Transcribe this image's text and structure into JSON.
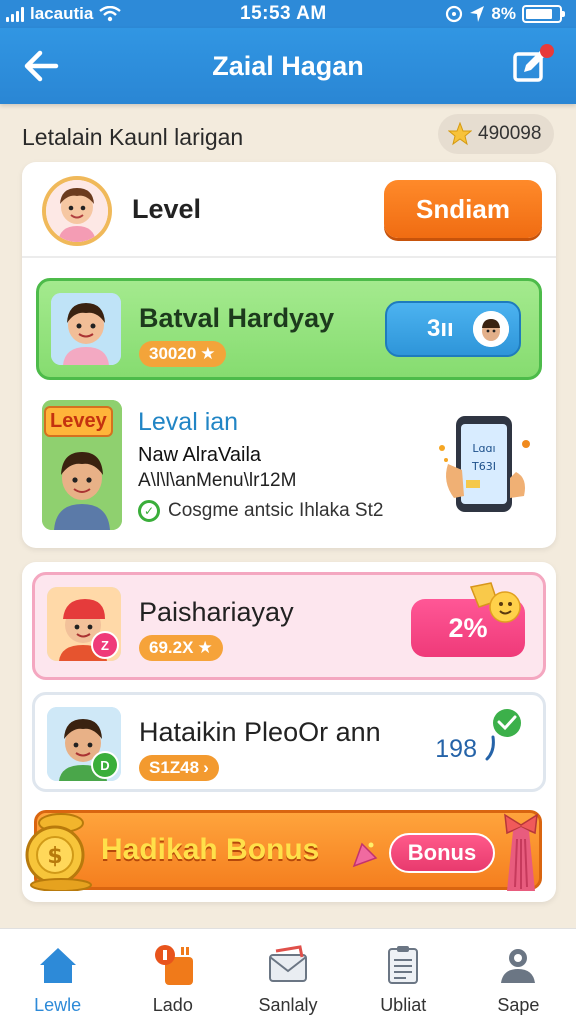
{
  "status_bar": {
    "carrier": "lacautia",
    "time": "15:53 AM",
    "battery_text": "8%",
    "battery_level": 0.8
  },
  "header": {
    "title": "Zaial Hagan",
    "back_icon": "arrow-left-icon",
    "edit_icon": "edit-square-icon"
  },
  "section": {
    "title": "Letalain Kaunl larigan",
    "star_count": "490098"
  },
  "level_row": {
    "label": "Level",
    "button_label": "Sndiam"
  },
  "green_row": {
    "title": "Batval Hardyay",
    "pill_value": "30020",
    "button_value": "3ıı"
  },
  "promo": {
    "badge": "Levey",
    "title": "Leval ian",
    "subtitle": "Naw AlraVaila",
    "subtitle2": "A\\l\\l\\anMenu\\lr12M",
    "check_text": "Cosgme antsic Ihlaka St2"
  },
  "list": [
    {
      "title": "Paishariayay",
      "pill_value": "69.2X",
      "action": "2%",
      "badge": "Z"
    },
    {
      "title": "Hataikin PleoOr ann",
      "pill_value": "S1Z48",
      "count": "198",
      "badge": "D"
    }
  ],
  "bonus": {
    "text": "Hadikah Bonus",
    "button_label": "Bonus"
  },
  "nav": [
    {
      "label": "Lewle",
      "icon": "home-icon",
      "active": true
    },
    {
      "label": "Lado",
      "icon": "gift-icon",
      "active": false
    },
    {
      "label": "Sanlaly",
      "icon": "mail-icon",
      "active": false
    },
    {
      "label": "Ubliat",
      "icon": "clipboard-icon",
      "active": false
    },
    {
      "label": "Sape",
      "icon": "profile-icon",
      "active": false
    }
  ],
  "colors": {
    "primary_blue": "#2d8ad8",
    "accent_orange": "#f06c12",
    "green": "#4dbb4a",
    "pink": "#ef3a79"
  }
}
